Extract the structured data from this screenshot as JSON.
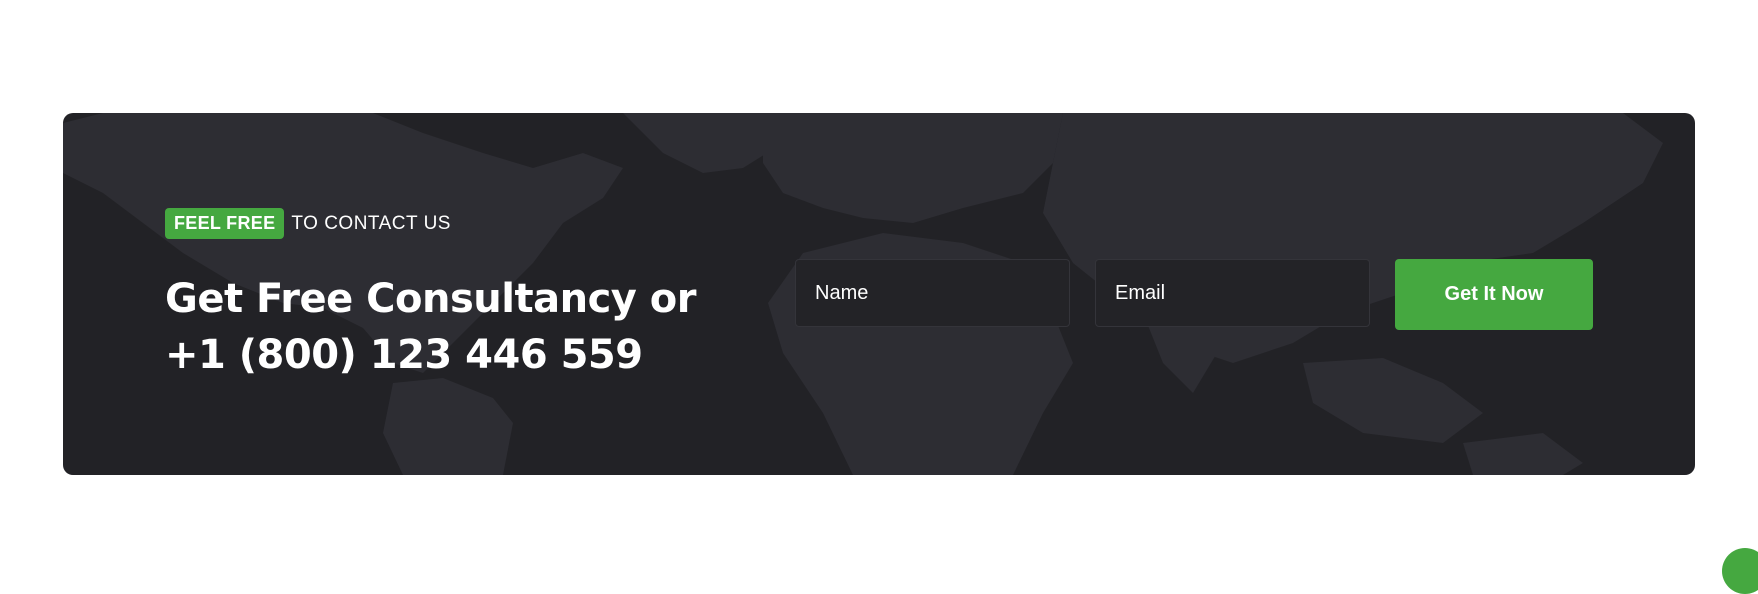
{
  "cta": {
    "badge": "FEEL FREE",
    "eyebrow": "TO CONTACT US",
    "headline": "Get Free Consultancy or +1 (800) 123 446 559"
  },
  "form": {
    "name_placeholder": "Name",
    "email_placeholder": "Email",
    "submit_label": "Get It Now"
  },
  "colors": {
    "accent": "#45a840",
    "banner_background": "#222226",
    "map_land": "#2d2d33",
    "text": "#ffffff"
  },
  "icons": {
    "scroll_top": "scroll-to-top-icon"
  }
}
